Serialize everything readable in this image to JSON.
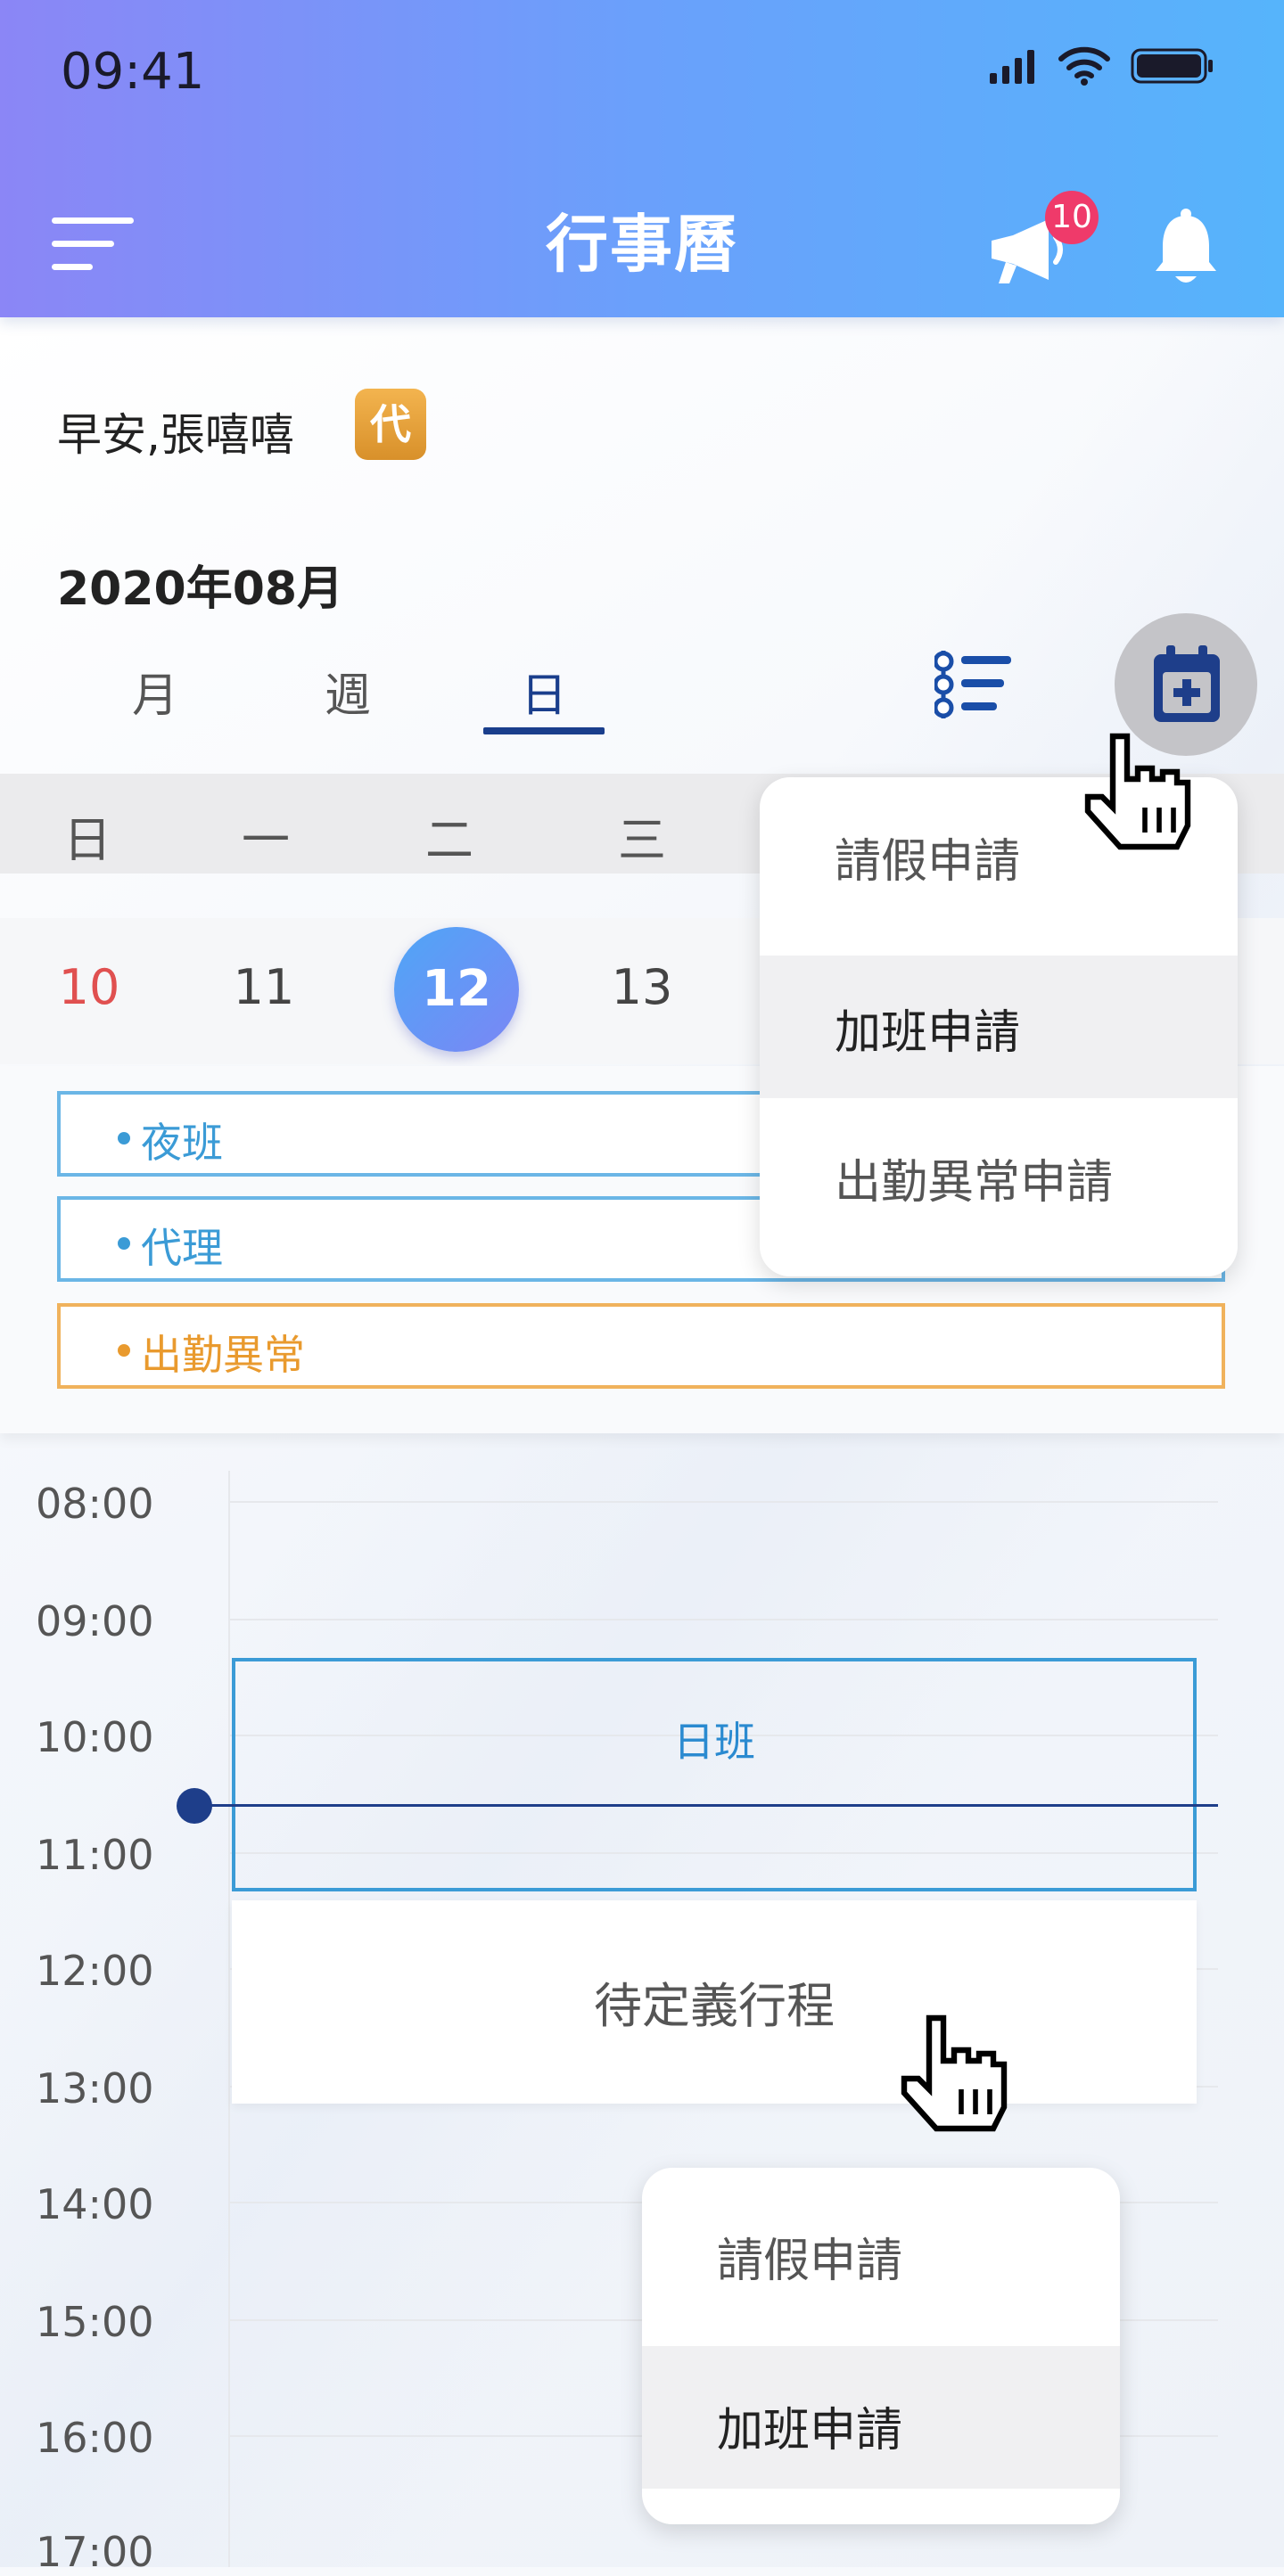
{
  "status_bar": {
    "time": "09:41"
  },
  "header": {
    "title": "行事曆",
    "announcement_count": "10"
  },
  "greeting": {
    "text": "早安,張嘻嘻",
    "badge": "代"
  },
  "calendar": {
    "month_label": "2020年08月",
    "tabs": [
      {
        "label": "月"
      },
      {
        "label": "週"
      },
      {
        "label": "日",
        "active": true
      }
    ],
    "weekdays": [
      "日",
      "一",
      "二",
      "三"
    ],
    "dates": [
      "10",
      "11",
      "12",
      "13"
    ],
    "selected_date": "12"
  },
  "events": [
    {
      "label": "夜班",
      "color": "#3b9bd6"
    },
    {
      "label": "代理",
      "color": "#3b9bd6"
    },
    {
      "label": "出勤異常",
      "color": "#e99a2e"
    }
  ],
  "timeline": {
    "hours": [
      "08:00",
      "09:00",
      "10:00",
      "11:00",
      "12:00",
      "13:00",
      "14:00",
      "15:00",
      "16:00",
      "17:00"
    ],
    "shift": {
      "label": "日班"
    },
    "pending": {
      "label": "待定義行程"
    }
  },
  "dropdown_top": {
    "items": [
      {
        "label": "請假申請"
      },
      {
        "label": "加班申請",
        "highlighted": true
      },
      {
        "label": "出勤異常申請"
      }
    ]
  },
  "dropdown_bottom": {
    "items": [
      {
        "label": "請假申請"
      },
      {
        "label": "加班申請",
        "highlighted": true
      }
    ]
  },
  "colors": {
    "header_start": "#8b86f6",
    "header_end": "#56b4fb",
    "accent_navy": "#1a3e8c",
    "badge_red": "#ef3a6a"
  }
}
